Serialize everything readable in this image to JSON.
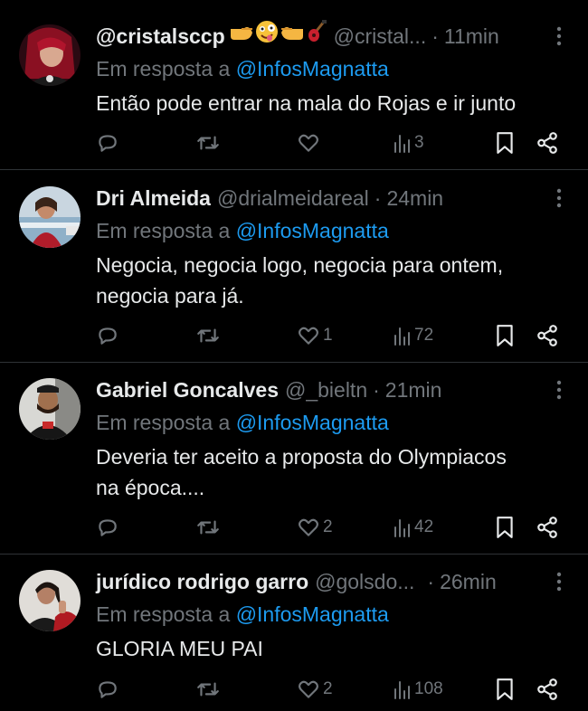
{
  "reply_prefix": "Em resposta a",
  "icons": {
    "reply": "reply-icon",
    "retweet": "retweet-icon",
    "like": "heart-icon",
    "views": "views-bar-chart-icon",
    "bookmark": "bookmark-icon",
    "share": "share-icon",
    "more": "more-vertical-icon"
  },
  "colors": {
    "background": "#000000",
    "text": "#e7e9ea",
    "muted": "#71767b",
    "link": "#1d9bf0",
    "divider": "#2f3336"
  },
  "tweets": [
    {
      "name": "@cristalsccp",
      "name_emojis": [
        "backhand-pointing-right-emoji",
        "zany-face-emoji",
        "backhand-pointing-left-emoji",
        "guitar-emoji"
      ],
      "handle": "@cristal...",
      "separator": "·",
      "time": "11min",
      "reply_to": "@InfosMagnatta",
      "text_lines": [
        "Então pode entrar na mala do Rojas e ir junto"
      ],
      "replies": "",
      "retweets": "",
      "likes": "",
      "views": "3"
    },
    {
      "name": "Dri Almeida",
      "name_emojis": [],
      "handle": "@drialmeidareal",
      "separator": "·",
      "time": "24min",
      "reply_to": "@InfosMagnatta",
      "text_lines": [
        "Negocia, negocia logo, negocia para ontem,",
        "negocia para já."
      ],
      "replies": "",
      "retweets": "",
      "likes": "1",
      "views": "72"
    },
    {
      "name": "Gabriel Goncalves",
      "name_emojis": [],
      "handle": "@_bieltn",
      "separator": "·",
      "time": "21min",
      "reply_to": "@InfosMagnatta",
      "text_lines": [
        "Deveria ter aceito a proposta do Olympiacos",
        "na época...."
      ],
      "replies": "",
      "retweets": "",
      "likes": "2",
      "views": "42"
    },
    {
      "name": "jurídico rodrigo garro",
      "name_emojis": [],
      "handle": "@golsdo...",
      "separator": "·",
      "time": "26min",
      "reply_to": "@InfosMagnatta",
      "text_lines": [
        "GLORIA MEU PAI"
      ],
      "replies": "",
      "retweets": "",
      "likes": "2",
      "views": "108"
    }
  ]
}
